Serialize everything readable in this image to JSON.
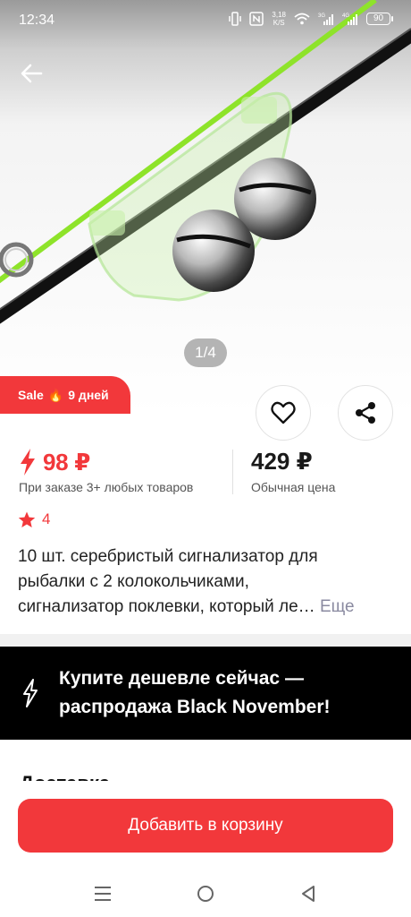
{
  "status_bar": {
    "time": "12:34",
    "net_speed": "3,18",
    "net_unit": "K/S",
    "battery": "90"
  },
  "product_image": {
    "pager": "1/4"
  },
  "sale_badge": {
    "label": "Sale",
    "emoji": "🔥",
    "days": "9 дней"
  },
  "price": {
    "sale_value": "98 ₽",
    "sale_note": "При заказе 3+ любых товаров",
    "regular_value": "429 ₽",
    "regular_note": "Обычная цена"
  },
  "rating": {
    "value": "4"
  },
  "product": {
    "title_line1": "10 шт. серебристый сигнализатор для",
    "title_line2": "рыбалки с 2 колокольчиками,",
    "title_line3": "сигнализатор поклевки, который ле…",
    "more": "Еще"
  },
  "promo": {
    "line1": "Купите дешевле сейчас —",
    "line2": "распродажа Black November!"
  },
  "delivery": {
    "heading": "Доставка"
  },
  "cart_button": {
    "label": "Добавить в корзину"
  },
  "colors": {
    "accent": "#f2383b",
    "promo_bg": "#000000"
  }
}
